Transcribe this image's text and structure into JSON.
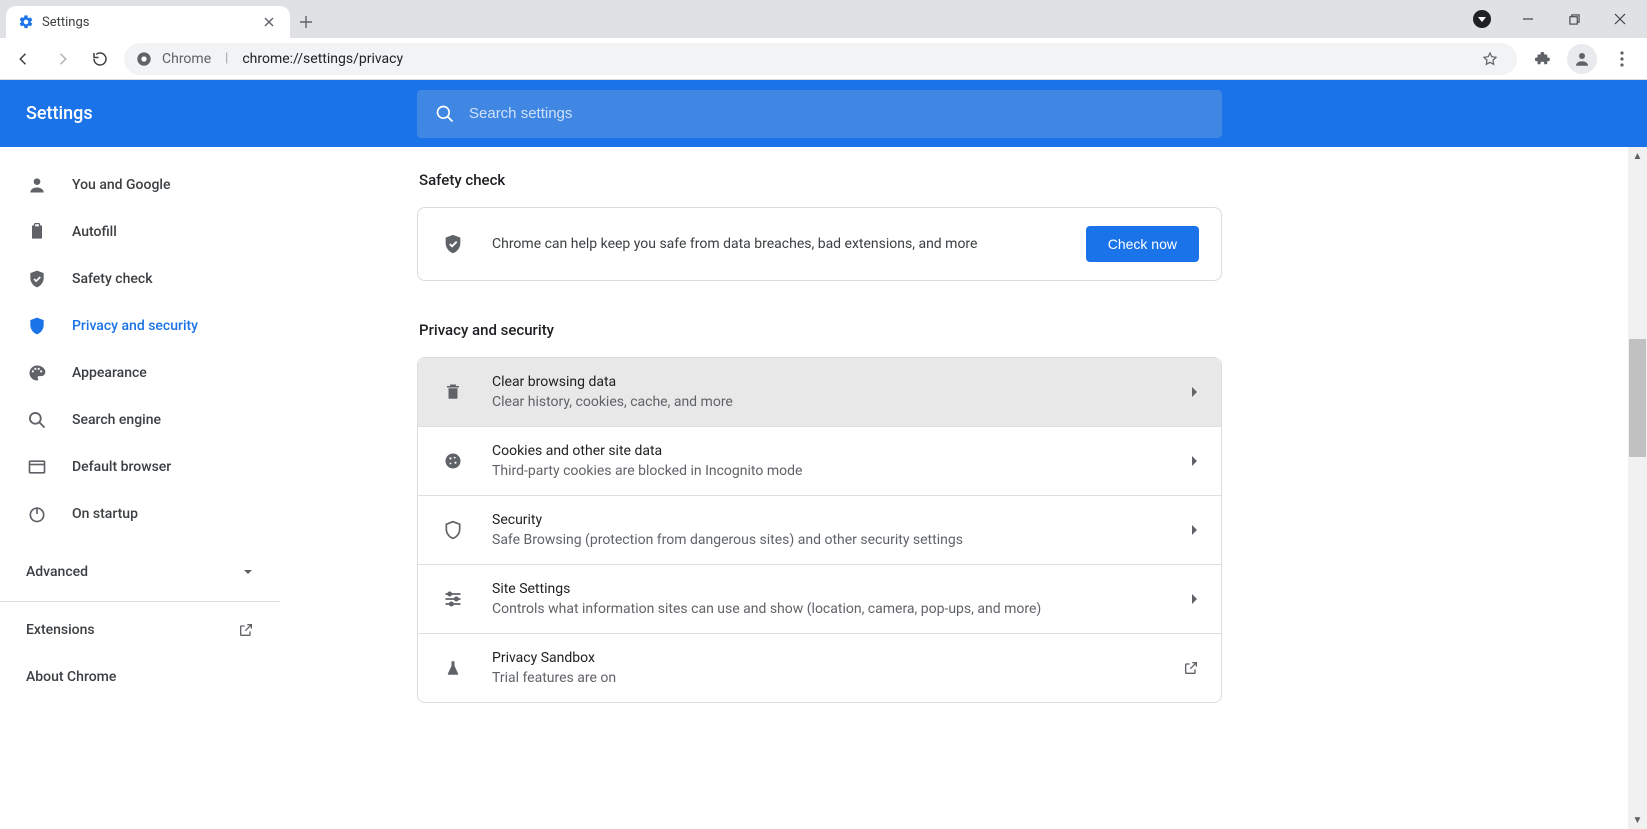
{
  "browser": {
    "tab_title": "Settings",
    "address_app": "Chrome",
    "address_url": "chrome://settings/privacy"
  },
  "header": {
    "title": "Settings",
    "search_placeholder": "Search settings"
  },
  "sidebar": {
    "items": [
      {
        "label": "You and Google"
      },
      {
        "label": "Autofill"
      },
      {
        "label": "Safety check"
      },
      {
        "label": "Privacy and security"
      },
      {
        "label": "Appearance"
      },
      {
        "label": "Search engine"
      },
      {
        "label": "Default browser"
      },
      {
        "label": "On startup"
      }
    ],
    "advanced": "Advanced",
    "extensions": "Extensions",
    "about": "About Chrome"
  },
  "main": {
    "safety_title": "Safety check",
    "safety_text": "Chrome can help keep you safe from data breaches, bad extensions, and more",
    "check_now": "Check now",
    "privacy_title": "Privacy and security",
    "rows": [
      {
        "title": "Clear browsing data",
        "sub": "Clear history, cookies, cache, and more"
      },
      {
        "title": "Cookies and other site data",
        "sub": "Third-party cookies are blocked in Incognito mode"
      },
      {
        "title": "Security",
        "sub": "Safe Browsing (protection from dangerous sites) and other security settings"
      },
      {
        "title": "Site Settings",
        "sub": "Controls what information sites can use and show (location, camera, pop-ups, and more)"
      },
      {
        "title": "Privacy Sandbox",
        "sub": "Trial features are on"
      }
    ]
  }
}
